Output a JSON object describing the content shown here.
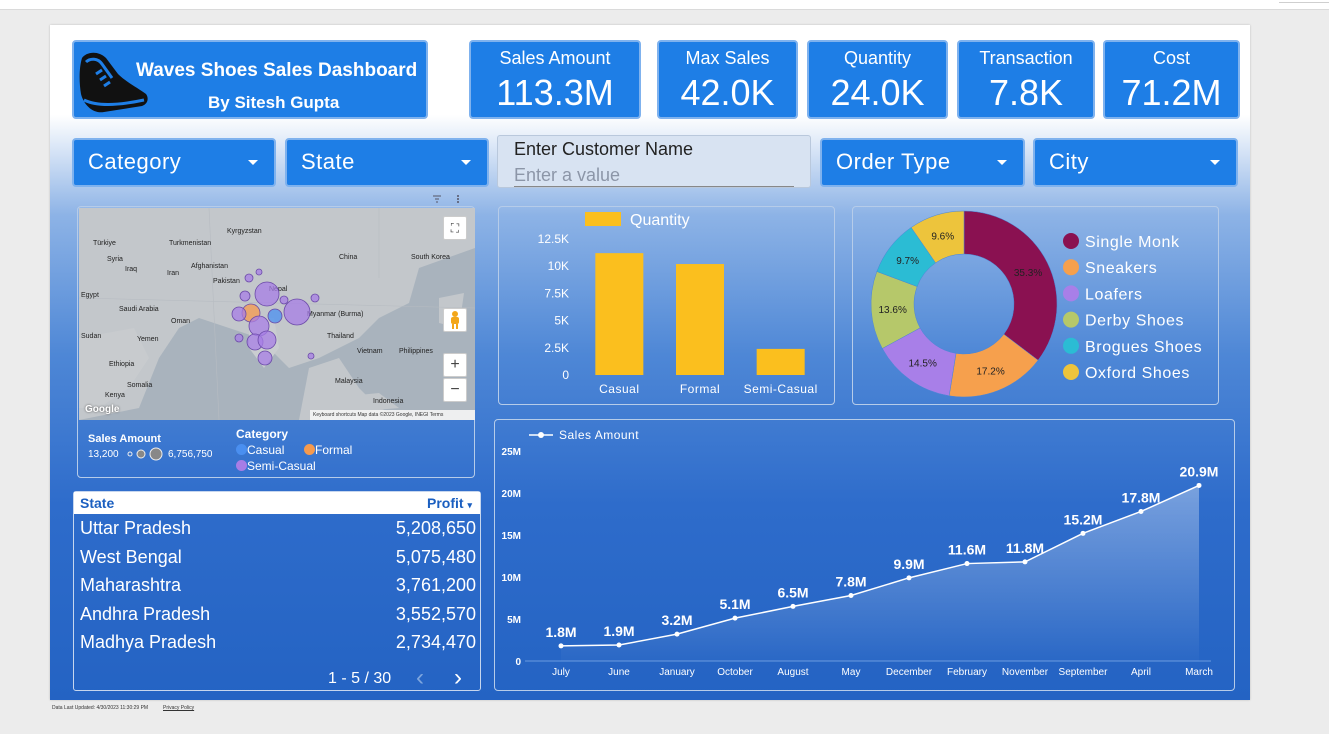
{
  "header": {
    "title": "Waves Shoes Sales Dashboard",
    "subtitle": "By Sitesh Gupta"
  },
  "kpis": [
    {
      "label": "Sales Amount",
      "value": "113.3M"
    },
    {
      "label": "Max Sales",
      "value": "42.0K"
    },
    {
      "label": "Quantity",
      "value": "24.0K"
    },
    {
      "label": "Transaction",
      "value": "7.8K"
    },
    {
      "label": "Cost",
      "value": "71.2M"
    }
  ],
  "filters": {
    "category": "Category",
    "state": "State",
    "order_type": "Order Type",
    "city": "City",
    "customer_label": "Enter Customer Name",
    "customer_placeholder": "Enter a value"
  },
  "map": {
    "labels": {
      "turkiye": "Türkiye",
      "turkmenistan": "Turkmenistan",
      "kyrgyzstan": "Kyrgyzstan",
      "syria": "Syria",
      "iraq": "Iraq",
      "iran": "Iran",
      "afghanistan": "Afghanistan",
      "pakistan": "Pakistan",
      "china": "China",
      "south_korea": "South Korea",
      "egypt": "Egypt",
      "saudi_arabia": "Saudi Arabia",
      "oman": "Oman",
      "nepal": "Nepal",
      "myanmar": "Myanmar (Burma)",
      "thailand": "Thailand",
      "sudan": "Sudan",
      "yemen": "Yemen",
      "ethiopia": "Ethiopia",
      "vietnam": "Vietnam",
      "philippines": "Philippines",
      "somalia": "Somalia",
      "malaysia": "Malaysia",
      "kenya": "Kenya",
      "indonesia": "Indonesia"
    },
    "attribution": "Keyboard shortcuts   Map data ©2023 Google, INEGI   Terms",
    "google_logo": "Google",
    "zoom_in": "+",
    "zoom_out": "−",
    "legend": {
      "size_title": "Sales Amount",
      "size_min": "13,200",
      "size_max": "6,756,750",
      "color_title": "Category",
      "items": [
        {
          "label": "Casual",
          "color": "#4a8ff0"
        },
        {
          "label": "Formal",
          "color": "#f59a4e"
        },
        {
          "label": "Semi-Casual",
          "color": "#a77de6"
        }
      ]
    }
  },
  "bar_chart": {
    "legend": "Quantity",
    "y_ticks": [
      "12.5K",
      "10K",
      "7.5K",
      "5K",
      "2.5K",
      "0"
    ],
    "color": "#fbbf1e"
  },
  "donut_chart": {
    "slices": [
      {
        "label": "Single Monk",
        "color": "#8a1151",
        "pct_label": "35.3%"
      },
      {
        "label": "Sneakers",
        "color": "#f6a04d",
        "pct_label": "17.2%"
      },
      {
        "label": "Loafers",
        "color": "#a87fe8",
        "pct_label": "14.5%"
      },
      {
        "label": "Derby Shoes",
        "color": "#b6c86a",
        "pct_label": "13.6%"
      },
      {
        "label": "Brogues Shoes",
        "color": "#2bbcd4",
        "pct_label": "9.7%"
      },
      {
        "label": "Oxford Shoes",
        "color": "#edc43c",
        "pct_label": "9.6%"
      }
    ]
  },
  "line_chart": {
    "legend": "Sales Amount",
    "y_ticks": [
      "25M",
      "20M",
      "15M",
      "10M",
      "5M",
      "0"
    ],
    "point_labels": [
      "1.8M",
      "1.9M",
      "3.2M",
      "5.1M",
      "6.5M",
      "7.8M",
      "9.9M",
      "11.6M",
      "11.8M",
      "15.2M",
      "17.8M",
      "20.9M"
    ]
  },
  "table": {
    "col_state": "State",
    "col_profit": "Profit",
    "sort_indicator": "▾",
    "rows": [
      {
        "state": "Uttar Pradesh",
        "profit": "5,208,650"
      },
      {
        "state": "West Bengal",
        "profit": "5,075,480"
      },
      {
        "state": "Maharashtra",
        "profit": "3,761,200"
      },
      {
        "state": "Andhra Pradesh",
        "profit": "3,552,570"
      },
      {
        "state": "Madhya Pradesh",
        "profit": "2,734,470"
      }
    ],
    "pager": "1 - 5 / 30",
    "prev": "‹",
    "next": "›"
  },
  "footer": {
    "updated": "Data Last Updated: 4/30/2023 11:30:29 PM",
    "privacy": "Privacy Policy"
  },
  "chart_data": [
    {
      "type": "bar",
      "categories": [
        "Casual",
        "Formal",
        "Semi-Casual"
      ],
      "series": [
        {
          "name": "Quantity",
          "values": [
            11200,
            10200,
            2400
          ]
        }
      ],
      "ylim": [
        0,
        12500
      ]
    },
    {
      "type": "pie",
      "categories": [
        "Single Monk",
        "Sneakers",
        "Loafers",
        "Derby Shoes",
        "Brogues Shoes",
        "Oxford Shoes"
      ],
      "values": [
        35.3,
        17.2,
        14.5,
        13.6,
        9.7,
        9.6
      ],
      "legend": "right"
    },
    {
      "type": "area",
      "categories": [
        "July",
        "June",
        "January",
        "October",
        "August",
        "May",
        "December",
        "February",
        "November",
        "September",
        "April",
        "March"
      ],
      "series": [
        {
          "name": "Sales Amount",
          "values": [
            1.8,
            1.9,
            3.2,
            5.1,
            6.5,
            7.8,
            9.9,
            11.6,
            11.8,
            15.2,
            17.8,
            20.9
          ]
        }
      ],
      "ylim": [
        0,
        25
      ],
      "ylabel": ""
    }
  ]
}
